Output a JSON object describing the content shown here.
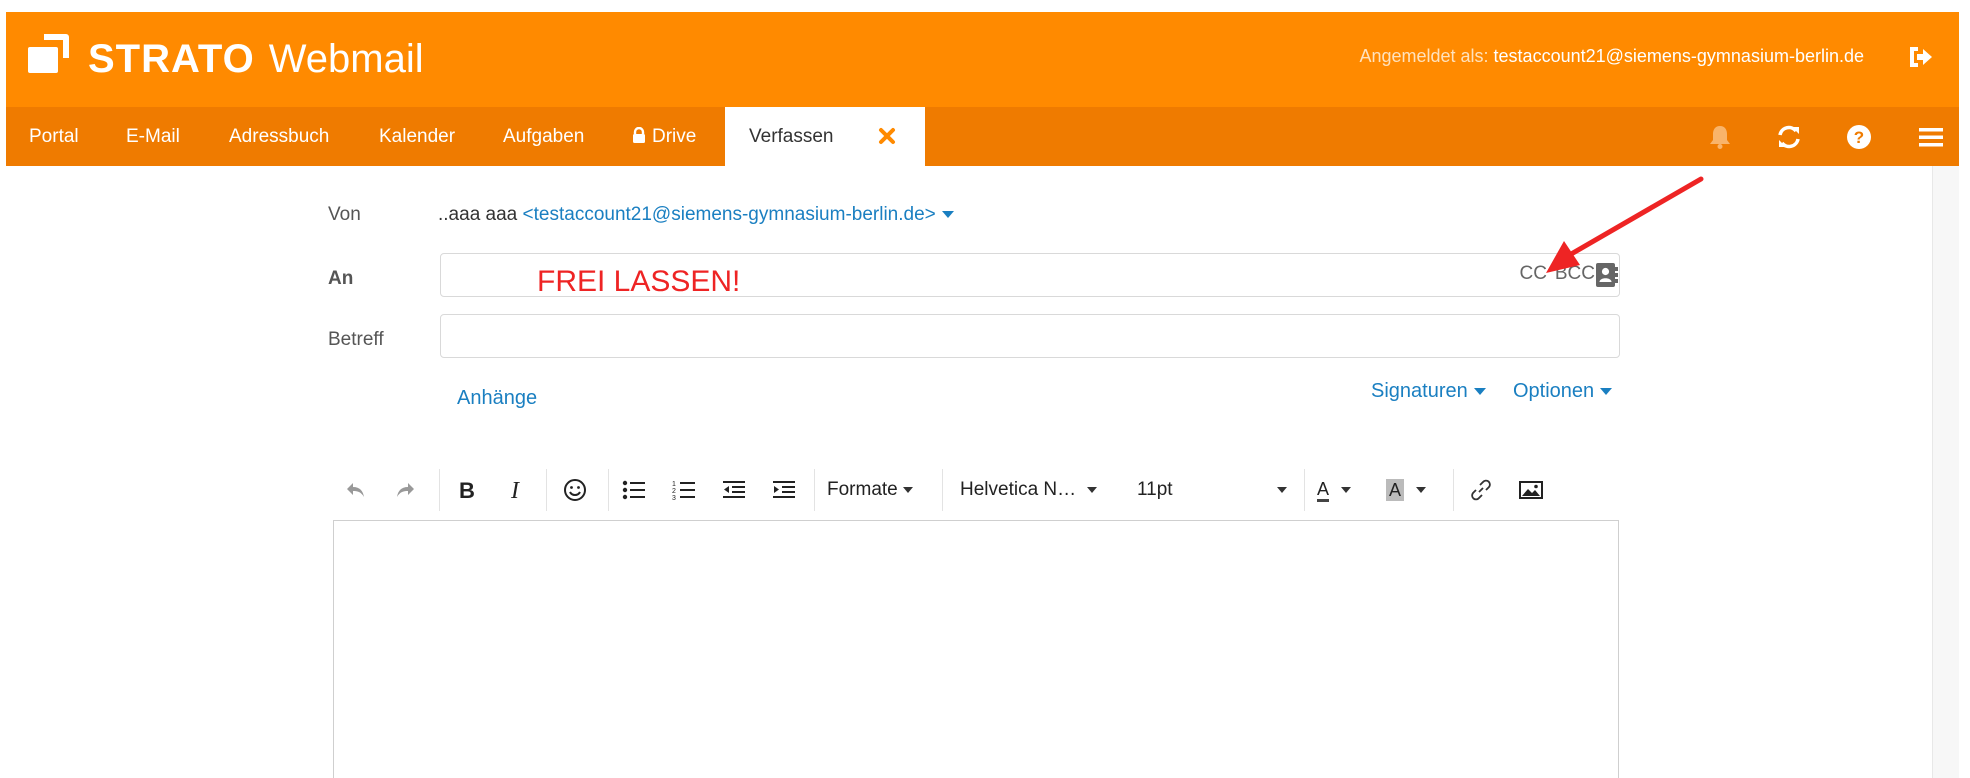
{
  "header": {
    "brand": "STRATO",
    "product": "Webmail",
    "login_label": "Angemeldet als:",
    "login_email": "testaccount21@siemens-gymnasium-berlin.de"
  },
  "nav": {
    "items": [
      "Portal",
      "E-Mail",
      "Adressbuch",
      "Kalender",
      "Aufgaben",
      "Drive"
    ],
    "active_tab": "Verfassen"
  },
  "form": {
    "from_label": "Von",
    "from_name": "..aaa aaa",
    "from_email": "<testaccount21@siemens-gymnasium-berlin.de>",
    "to_label": "An",
    "to_value": "",
    "cc_label": "CC",
    "bcc_label": "BCC",
    "subject_label": "Betreff",
    "subject_value": "",
    "attachments_label": "Anhänge",
    "signatures_label": "Signaturen",
    "options_label": "Optionen"
  },
  "toolbar": {
    "formats_label": "Formate",
    "font_label": "Helvetica N…",
    "size_label": "11pt",
    "text_color_letter": "A",
    "bg_color_letter": "A"
  },
  "annotation": {
    "text": "FREI LASSEN!"
  },
  "colors": {
    "header_orange": "#ff8a00",
    "nav_orange": "#ef7b00",
    "link_blue": "#1a7fc1",
    "annotation_red": "#ee2424"
  }
}
